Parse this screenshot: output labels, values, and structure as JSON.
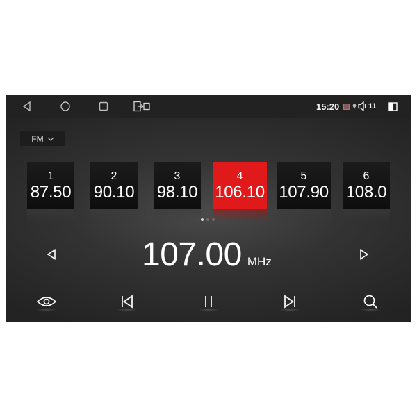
{
  "statusbar": {
    "nav": {
      "back_icon": "triangle-back-icon",
      "home_icon": "circle-home-icon",
      "recents_icon": "square-recents-icon",
      "split_icon": "split-screen-icon"
    },
    "time": "15:20",
    "volume_level": "11",
    "icons": [
      "sd-card-icon",
      "gps-icon",
      "speaker-icon",
      "window-toggle-icon"
    ]
  },
  "band": {
    "label": "FM",
    "dropdown_icon": "chevron-down-icon"
  },
  "presets": [
    {
      "number": "1",
      "frequency": "87.50",
      "active": false
    },
    {
      "number": "2",
      "frequency": "90.10",
      "active": false
    },
    {
      "number": "3",
      "frequency": "98.10",
      "active": false
    },
    {
      "number": "4",
      "frequency": "106.10",
      "active": true
    },
    {
      "number": "5",
      "frequency": "107.90",
      "active": false
    },
    {
      "number": "6",
      "frequency": "108.0",
      "active": false
    }
  ],
  "page_indicator": {
    "pages": 3,
    "current": 1
  },
  "tuner": {
    "frequency": "107.00",
    "unit": "MHz"
  },
  "controls": {
    "view_icon": "eye-icon",
    "prev_icon": "skip-previous-icon",
    "pause_icon": "pause-icon",
    "next_icon": "skip-next-icon",
    "search_icon": "search-icon",
    "seek_back_icon": "triangle-left-icon",
    "seek_forward_icon": "triangle-right-icon"
  },
  "colors": {
    "accent": "#e01a1a",
    "background": "#2f2f2f",
    "text": "#ffffff"
  }
}
